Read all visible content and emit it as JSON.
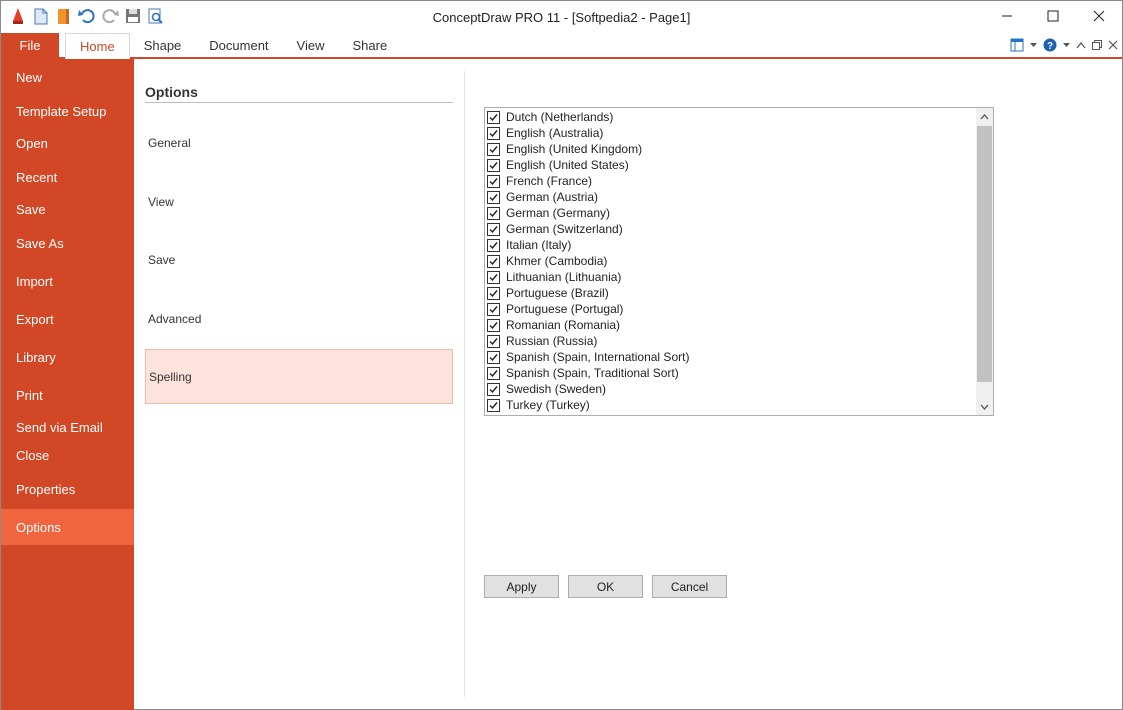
{
  "window": {
    "title": "ConceptDraw PRO 11 - [Softpedia2 - Page1]"
  },
  "qat": [
    "app-logo-icon",
    "new-document-icon",
    "open-book-icon",
    "undo-icon",
    "redo-icon",
    "save-icon",
    "print-preview-icon"
  ],
  "ribbon": {
    "file_label": "File",
    "tabs": [
      {
        "label": "Home",
        "active": true
      },
      {
        "label": "Shape",
        "active": false
      },
      {
        "label": "Document",
        "active": false
      },
      {
        "label": "View",
        "active": false
      },
      {
        "label": "Share",
        "active": false
      }
    ]
  },
  "backstage": {
    "items": [
      "New",
      "Template Setup",
      "Open",
      "Recent",
      "Save",
      "Save As",
      "Import",
      "Export",
      "Library",
      "Print",
      "Send via Email",
      "Close",
      "Properties",
      "Options"
    ],
    "active": "Options"
  },
  "options": {
    "heading": "Options",
    "items": [
      "General",
      "View",
      "Save",
      "Advanced",
      "Spelling"
    ],
    "active": "Spelling"
  },
  "languages": [
    {
      "label": "Dutch (Netherlands)",
      "checked": true
    },
    {
      "label": "English (Australia)",
      "checked": true
    },
    {
      "label": "English (United Kingdom)",
      "checked": true
    },
    {
      "label": "English (United States)",
      "checked": true
    },
    {
      "label": "French (France)",
      "checked": true
    },
    {
      "label": "German (Austria)",
      "checked": true
    },
    {
      "label": "German (Germany)",
      "checked": true
    },
    {
      "label": "German (Switzerland)",
      "checked": true
    },
    {
      "label": "Italian (Italy)",
      "checked": true
    },
    {
      "label": "Khmer (Cambodia)",
      "checked": true
    },
    {
      "label": "Lithuanian (Lithuania)",
      "checked": true
    },
    {
      "label": "Portuguese (Brazil)",
      "checked": true
    },
    {
      "label": "Portuguese (Portugal)",
      "checked": true
    },
    {
      "label": "Romanian (Romania)",
      "checked": true
    },
    {
      "label": "Russian (Russia)",
      "checked": true
    },
    {
      "label": "Spanish (Spain, International Sort)",
      "checked": true
    },
    {
      "label": "Spanish (Spain, Traditional Sort)",
      "checked": true
    },
    {
      "label": "Swedish (Sweden)",
      "checked": true
    },
    {
      "label": "Turkey (Turkey)",
      "checked": true
    }
  ],
  "buttons": {
    "apply": "Apply",
    "ok": "OK",
    "cancel": "Cancel"
  },
  "colors": {
    "accent": "#d24726",
    "active_backstage": "#f0653d",
    "selected_option_bg": "#fde3dc"
  }
}
